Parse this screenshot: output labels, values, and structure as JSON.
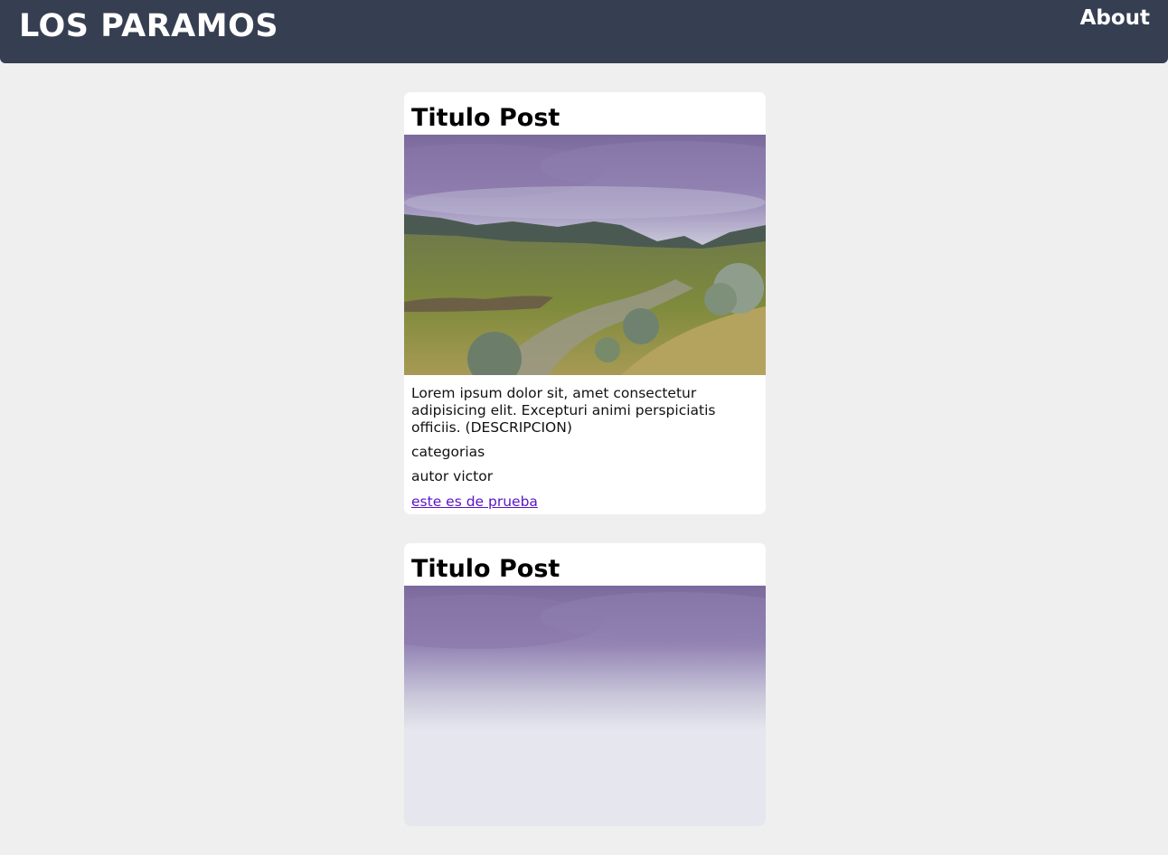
{
  "navbar": {
    "brand": "LOS PARAMOS",
    "about_label": "About"
  },
  "posts": [
    {
      "title": "Titulo Post",
      "description": "Lorem ipsum dolor sit, amet consectetur adipisicing elit. Excepturi animi perspiciatis officiis. (DESCRIPCION)",
      "categories": "categorias",
      "author": "autor victor",
      "link_text": "este es de prueba"
    },
    {
      "title": "Titulo Post"
    }
  ],
  "colors": {
    "navbar_bg": "#363f52",
    "page_bg": "#efefef",
    "card_bg": "#ffffff",
    "link": "#5a14c8"
  }
}
